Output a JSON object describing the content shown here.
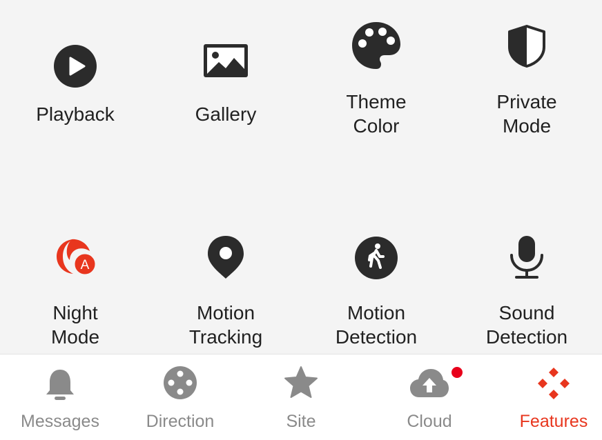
{
  "features": [
    {
      "id": "playback",
      "label": "Playback",
      "icon": "play-circle-icon"
    },
    {
      "id": "gallery",
      "label": "Gallery",
      "icon": "image-icon"
    },
    {
      "id": "theme-color",
      "label": "Theme\nColor",
      "icon": "palette-icon"
    },
    {
      "id": "private-mode",
      "label": "Private\nMode",
      "icon": "shield-icon"
    },
    {
      "id": "night-mode",
      "label": "Night\nMode",
      "icon": "night-auto-icon"
    },
    {
      "id": "motion-tracking",
      "label": "Motion\nTracking",
      "icon": "location-pin-icon"
    },
    {
      "id": "motion-detection",
      "label": "Motion\nDetection",
      "icon": "walking-person-icon"
    },
    {
      "id": "sound-detection",
      "label": "Sound\nDetection",
      "icon": "microphone-icon"
    }
  ],
  "tabs": [
    {
      "id": "messages",
      "label": "Messages",
      "icon": "bell-icon",
      "active": false
    },
    {
      "id": "direction",
      "label": "Direction",
      "icon": "direction-pad-icon",
      "active": false
    },
    {
      "id": "site",
      "label": "Site",
      "icon": "star-icon",
      "active": false
    },
    {
      "id": "cloud",
      "label": "Cloud",
      "icon": "cloud-upload-icon",
      "active": false,
      "badge": true
    },
    {
      "id": "features",
      "label": "Features",
      "icon": "features-grid-icon",
      "active": true
    }
  ],
  "colors": {
    "icon_dark": "#2b2b2b",
    "accent": "#e8361e",
    "tab_inactive": "#8a8a8a",
    "badge": "#e8001b",
    "panel_bg": "#f4f4f4"
  }
}
